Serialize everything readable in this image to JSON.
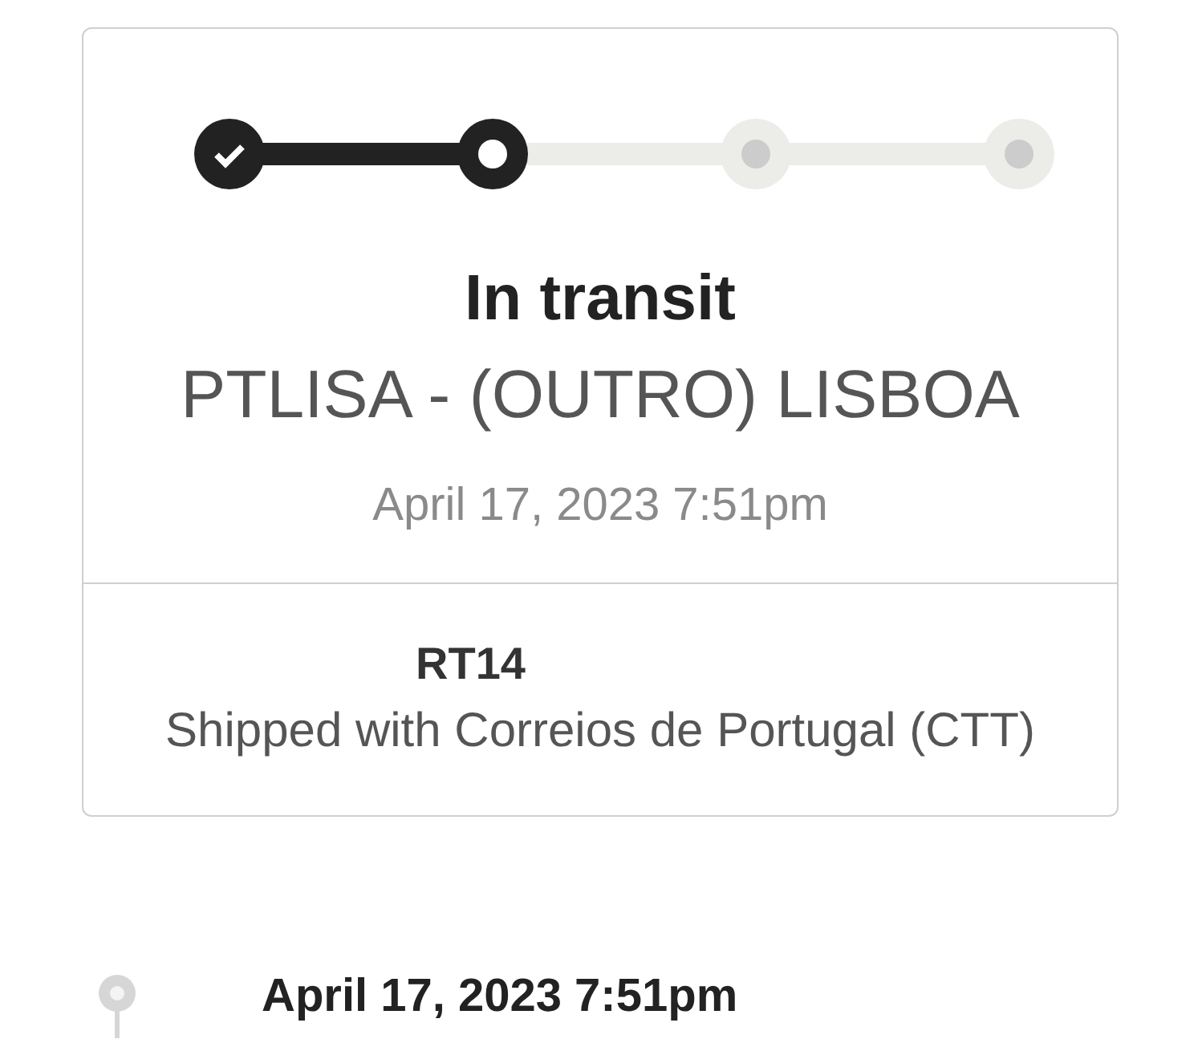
{
  "card": {
    "steps": [
      {
        "kind": "complete"
      },
      {
        "kind": "current"
      },
      {
        "kind": "pending"
      },
      {
        "kind": "pending"
      }
    ],
    "status": "In transit",
    "location": "PTLISA - (OUTRO) LISBOA",
    "updated": "April 17, 2023 7:51pm",
    "tracking_number": "RT14",
    "carrier": "Shipped with Correios de Portugal (CTT)"
  },
  "events": [
    {
      "date": "April 17, 2023 7:51pm"
    }
  ]
}
